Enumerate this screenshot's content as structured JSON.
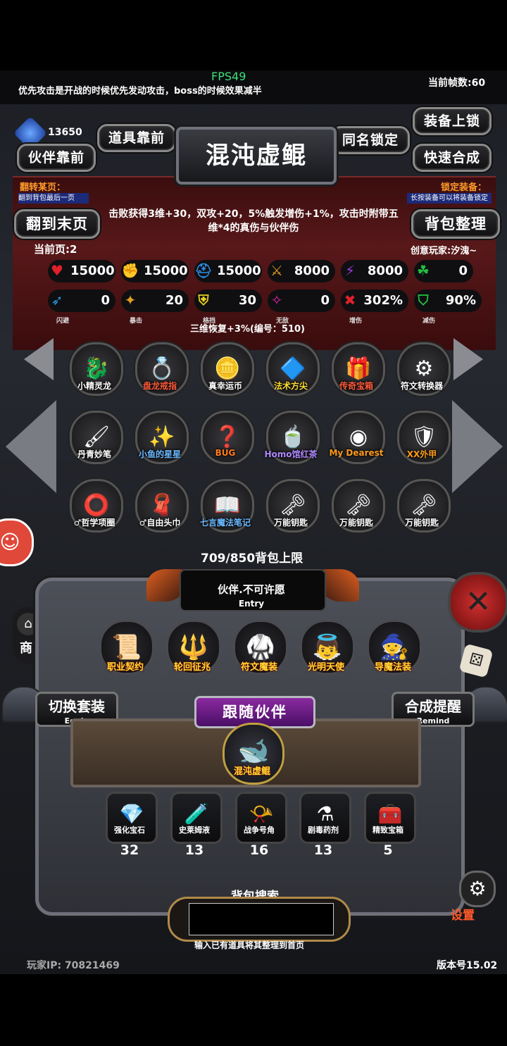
{
  "header": {
    "fps": "FPS49",
    "tip": "优先攻击是开战的时候优先发动攻击，boss的时候效果减半",
    "frame_rate": "当前帧数:60",
    "gem_count": "13650"
  },
  "buttons": {
    "item_front": "道具靠前",
    "partner_front": "伙伴靠前",
    "same_name_lock": "同名锁定",
    "equip_lock": "装备上锁",
    "quick_merge": "快速合成",
    "last_page": "翻到末页",
    "sort_bag": "背包整理"
  },
  "title": "混沌虚鲲",
  "tags": {
    "flip_label": "翻转某页：",
    "flip_sub": "翻到背包最后一页",
    "lock_label": "锁定装备：",
    "lock_sub": "长按装备可以将装备锁定"
  },
  "description": "击败获得3维+30，双攻+20，5%触发增伤+1%，攻击时附带五维*4的真伤与伙伴伤",
  "current_page": "当前页:2",
  "player": "创意玩家:汐溾~",
  "stats": [
    {
      "icon": "heart-icon",
      "glyph": "♥",
      "color": "#e0202a",
      "value": "15000",
      "label": ""
    },
    {
      "icon": "muscle-icon",
      "glyph": "✊",
      "color": "#e8b820",
      "value": "15000",
      "label": ""
    },
    {
      "icon": "helmet-icon",
      "glyph": "⛑",
      "color": "#2a8ae0",
      "value": "15000",
      "label": ""
    },
    {
      "icon": "sword-icon",
      "glyph": "⚔",
      "color": "#e09a20",
      "value": "8000",
      "label": ""
    },
    {
      "icon": "lightning-icon",
      "glyph": "⚡",
      "color": "#9a3ae0",
      "value": "8000",
      "label": ""
    },
    {
      "icon": "clover-icon",
      "glyph": "☘",
      "color": "#22c040",
      "value": "0",
      "label": ""
    },
    {
      "icon": "dodge-icon",
      "glyph": "➶",
      "color": "#2a9ae8",
      "value": "0",
      "label": "闪避"
    },
    {
      "icon": "crit-icon",
      "glyph": "✦",
      "color": "#e0a020",
      "value": "20",
      "label": "暴击"
    },
    {
      "icon": "block-icon",
      "glyph": "⛨",
      "color": "#e8d020",
      "value": "30",
      "label": "格挡"
    },
    {
      "icon": "invincible-icon",
      "glyph": "✧",
      "color": "#e02aa8",
      "value": "0",
      "label": "无敌"
    },
    {
      "icon": "damage-up-icon",
      "glyph": "✖",
      "color": "#e0202a",
      "value": "302%",
      "label": "增伤"
    },
    {
      "icon": "damage-down-icon",
      "glyph": "⛉",
      "color": "#22c040",
      "value": "90%",
      "label": "减伤"
    }
  ],
  "recover_text": "三维恢复+3%(编号：510)",
  "inventory": [
    {
      "name": "小精灵龙",
      "icon": "dragon-icon",
      "glyph": "🐉",
      "color": "#fff"
    },
    {
      "name": "盘龙戒指",
      "icon": "ring-icon",
      "glyph": "💍",
      "color": "#ff5a3a"
    },
    {
      "name": "真幸运币",
      "icon": "coin-icon",
      "glyph": "🪙",
      "color": "#fff"
    },
    {
      "name": "法术方尖",
      "icon": "wizard-hat-icon",
      "glyph": "🔷",
      "color": "#ffdd33"
    },
    {
      "name": "传奇宝箱",
      "icon": "treasure-chest-icon",
      "glyph": "🎁",
      "color": "#ff5a3a"
    },
    {
      "name": "符文转换器",
      "icon": "rune-converter-icon",
      "glyph": "⚙",
      "color": "#fff"
    },
    {
      "name": "丹青妙笔",
      "icon": "brush-icon",
      "glyph": "🖌",
      "color": "#fff"
    },
    {
      "name": "小鱼的星星",
      "icon": "star-wand-icon",
      "glyph": "✨",
      "color": "#6ab8ff"
    },
    {
      "name": "BUG",
      "icon": "bug-icon",
      "glyph": "❓",
      "color": "#ff7a1a"
    },
    {
      "name": "Homo馆红茶",
      "icon": "tea-icon",
      "glyph": "🍵",
      "color": "#b088ff"
    },
    {
      "name": "My Dearest",
      "icon": "eye-orb-icon",
      "glyph": "◉",
      "color": "#ff9a1a"
    },
    {
      "name": "XX外甲",
      "icon": "armor-icon",
      "glyph": "🛡",
      "color": "#ff9a1a"
    },
    {
      "name": "♂哲学项圈",
      "icon": "collar-icon",
      "glyph": "⭕",
      "color": "#fff"
    },
    {
      "name": "♂自由头巾",
      "icon": "bandana-icon",
      "glyph": "🧣",
      "color": "#fff"
    },
    {
      "name": "七言魔法笔记",
      "icon": "spellbook-icon",
      "glyph": "📖",
      "color": "#6ab8ff"
    },
    {
      "name": "万能钥匙",
      "icon": "key-icon",
      "glyph": "🗝",
      "color": "#fff"
    },
    {
      "name": "万能钥匙",
      "icon": "key-icon",
      "glyph": "🗝",
      "color": "#fff"
    },
    {
      "name": "万能钥匙",
      "icon": "key-icon",
      "glyph": "🗝",
      "color": "#fff"
    }
  ],
  "bag_limit": "709/850背包上限",
  "entry": {
    "title": "伙伴.不可许愿",
    "sub": "Entry"
  },
  "equipment": [
    {
      "name": "职业契约",
      "icon": "scroll-icon",
      "glyph": "📜"
    },
    {
      "name": "轮回征兆",
      "icon": "spear-icon",
      "glyph": "🔱"
    },
    {
      "name": "符文魔装",
      "icon": "rune-armor-icon",
      "glyph": "🥋"
    },
    {
      "name": "光明天使",
      "icon": "angel-icon",
      "glyph": "👼"
    },
    {
      "name": "导魔法装",
      "icon": "wizard-icon",
      "glyph": "🧙"
    }
  ],
  "side": {
    "switch_set": "切换套装",
    "switch_sub": "Equip",
    "merge_remind": "合成提醒",
    "merge_sub": "Remind",
    "shop_partial": "商",
    "settings": "设置"
  },
  "follow": {
    "label": "跟随伙伴",
    "partner_name": "混沌虚鲲"
  },
  "materials": [
    {
      "name": "强化宝石",
      "count": "32",
      "icon": "gem-icon",
      "glyph": "💎"
    },
    {
      "name": "史莱姆液",
      "count": "13",
      "icon": "potion-icon",
      "glyph": "🧪"
    },
    {
      "name": "战争号角",
      "count": "16",
      "icon": "horn-icon",
      "glyph": "📯"
    },
    {
      "name": "剧毒药剂",
      "count": "13",
      "icon": "poison-icon",
      "glyph": "⚗"
    },
    {
      "name": "精致宝箱",
      "count": "5",
      "icon": "chest-icon",
      "glyph": "🧰"
    }
  ],
  "search": {
    "label": "背包搜索",
    "placeholder": "",
    "hint": "输入已有道具将其整理到首页"
  },
  "footer": {
    "player_ip": "玩家IP:  70821469",
    "version": "版本号15.02"
  }
}
